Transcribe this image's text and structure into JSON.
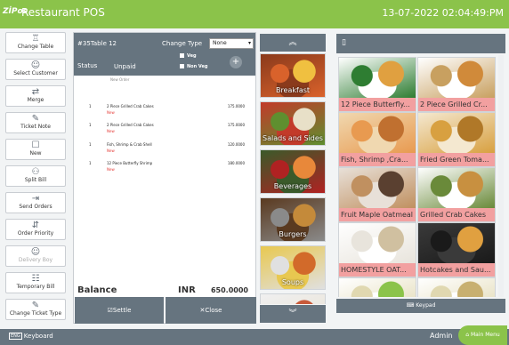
{
  "app": {
    "logo": "ZİPos",
    "title": "Restaurant POS",
    "datetime": "13-07-2022 02:04:49:PM"
  },
  "sidebar": [
    {
      "label": "Change Table",
      "icon": "table-icon",
      "glyph": "♖",
      "enabled": true
    },
    {
      "label": "Select Customer",
      "icon": "person-icon",
      "glyph": "☺",
      "enabled": true
    },
    {
      "label": "Merge",
      "icon": "merge-icon",
      "glyph": "⇄",
      "enabled": true
    },
    {
      "label": "Ticket Note",
      "icon": "pencil-icon",
      "glyph": "✎",
      "enabled": true
    },
    {
      "label": "New",
      "icon": "document-icon",
      "glyph": "☐",
      "enabled": true
    },
    {
      "label": "Split Bill",
      "icon": "split-icon",
      "glyph": "⚇",
      "enabled": true
    },
    {
      "label": "Send Orders",
      "icon": "send-icon",
      "glyph": "⇥",
      "enabled": true
    },
    {
      "label": "Order Priority",
      "icon": "priority-icon",
      "glyph": "⇵",
      "enabled": true
    },
    {
      "label": "Delivery Boy",
      "icon": "delivery-icon",
      "glyph": "☺",
      "enabled": false
    },
    {
      "label": "Temporary Bill",
      "icon": "bill-icon",
      "glyph": "☷",
      "enabled": true
    },
    {
      "label": "Change Ticket Type",
      "icon": "edit-ticket-icon",
      "glyph": "✎",
      "enabled": true
    }
  ],
  "order": {
    "table": "#35Table 12",
    "change_type_label": "Change Type",
    "change_type_value": "None",
    "veg_label": "Veg",
    "nonveg_label": "Non Veg",
    "status_label": "Status",
    "status_value": "Unpaid",
    "new_order_label": "New Order",
    "items": [
      {
        "qty": "1",
        "name": "2 Piece Grilled Crab Cakes",
        "status": "New",
        "price": "175.0000"
      },
      {
        "qty": "1",
        "name": "2 Piece Grilled Crab Cakes",
        "status": "New",
        "price": "175.0000"
      },
      {
        "qty": "1",
        "name": "Fish, Shrimp & Crab Shell",
        "status": "New",
        "price": "120.0000"
      },
      {
        "qty": "1",
        "name": "12 Piece Butterfly Shrimp",
        "status": "New",
        "price": "180.0000"
      }
    ],
    "balance_label": "Balance",
    "currency": "INR",
    "balance_value": "650.0000"
  },
  "actions": {
    "settle": "Settle",
    "close": "Close"
  },
  "categories": [
    {
      "label": "Breakfast",
      "colors": [
        "#d9622b",
        "#f0c040",
        "#8a3a1c"
      ]
    },
    {
      "label": "Salads and Sides",
      "colors": [
        "#5f8f2f",
        "#e8e0c8",
        "#c23a2a"
      ]
    },
    {
      "label": "Beverages",
      "colors": [
        "#b02222",
        "#e8883a",
        "#3a5a2a"
      ]
    },
    {
      "label": "Burgers",
      "colors": [
        "#8a8a8a",
        "#c48a3a",
        "#5a3a20"
      ]
    },
    {
      "label": "Soups",
      "colors": [
        "#e0e0e0",
        "#d26a2a",
        "#e8c850"
      ]
    },
    {
      "label": "",
      "colors": [
        "#e8e0d0",
        "#c85a3a",
        "#f0f0f0"
      ]
    }
  ],
  "items": [
    {
      "name": "12 Piece Butterfly...",
      "colors": [
        "#2e7d32",
        "#e0a040",
        "#ffffff"
      ]
    },
    {
      "name": "2 Piece Grilled Cr...",
      "colors": [
        "#c8a060",
        "#d08a3a",
        "#ffffff"
      ]
    },
    {
      "name": "Fish, Shrimp ,Cra...",
      "colors": [
        "#e89a50",
        "#c07030",
        "#f0d8b0"
      ]
    },
    {
      "name": "Fried Green Toma...",
      "colors": [
        "#d8a040",
        "#b07828",
        "#f4e8d0"
      ]
    },
    {
      "name": "Fruit Maple Oatmeal",
      "colors": [
        "#c09060",
        "#5a4030",
        "#e8e0d8"
      ]
    },
    {
      "name": "Grilled Crab Cakes",
      "colors": [
        "#6a8a3a",
        "#c89040",
        "#ffffff"
      ]
    },
    {
      "name": "HOMESTYLE OAT...",
      "colors": [
        "#e8e4dc",
        "#d0c0a0",
        "#ffffff"
      ]
    },
    {
      "name": "Hotcakes and Sau...",
      "colors": [
        "#1a1a1a",
        "#e0a040",
        "#3a3a3a"
      ]
    },
    {
      "name": "",
      "colors": [
        "#e0d8b0",
        "#8bc34a",
        "#ffffff"
      ]
    },
    {
      "name": "",
      "colors": [
        "#e0d8b0",
        "#c8b070",
        "#ffffff"
      ]
    }
  ],
  "keypad_label": "Keypad",
  "bottom": {
    "keyboard_label": "Keyboard",
    "keyboard_key": "ENG",
    "user": "Admin",
    "main_menu": "Main Menu"
  }
}
